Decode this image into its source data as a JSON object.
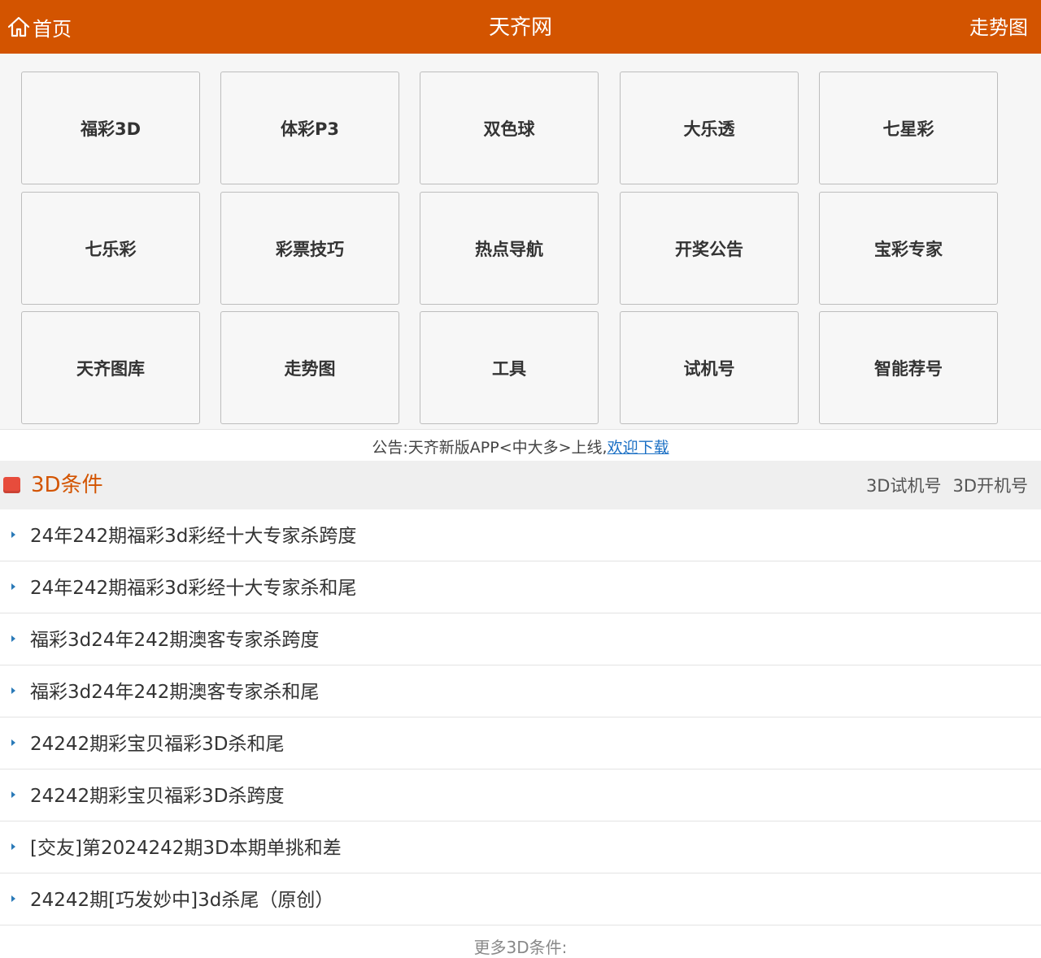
{
  "header": {
    "home_label": "首页",
    "title": "天齐网",
    "trend_label": "走势图"
  },
  "nav_tiles": [
    "福彩3D",
    "体彩P3",
    "双色球",
    "大乐透",
    "七星彩",
    "七乐彩",
    "彩票技巧",
    "热点导航",
    "开奖公告",
    "宝彩专家",
    "天齐图库",
    "走势图",
    "工具",
    "试机号",
    "智能荐号"
  ],
  "notice": {
    "text": "公告:天齐新版APP<中大多>上线,",
    "link": "欢迎下载"
  },
  "section": {
    "title": "3D条件",
    "link1": "3D试机号",
    "link2": "3D开机号"
  },
  "articles": [
    "24年242期福彩3d彩经十大专家杀跨度",
    "24年242期福彩3d彩经十大专家杀和尾",
    "福彩3d24年242期澳客专家杀跨度",
    "福彩3d24年242期澳客专家杀和尾",
    "24242期彩宝贝福彩3D杀和尾",
    "24242期彩宝贝福彩3D杀跨度",
    "[交友]第2024242期3D本期单挑和差",
    "24242期[巧发妙中]3d杀尾（原创）"
  ],
  "more_label": "更多3D条件:",
  "colors": {
    "brand": "#d35400",
    "link": "#1a6fc4",
    "marker": "#e74c3c"
  }
}
